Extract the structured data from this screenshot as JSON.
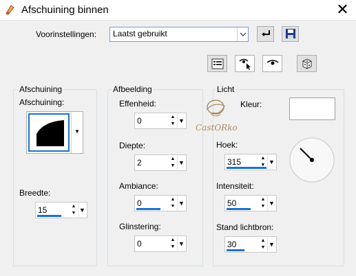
{
  "window": {
    "title": "Afschuining binnen",
    "close_glyph": "✕"
  },
  "presets": {
    "label": "Voorinstellingen:",
    "selected": "Laatst gebruikt",
    "reset_icon": "reset-icon",
    "save_icon": "save-icon"
  },
  "toolbar": {
    "icons": [
      "list-icon",
      "eye-pointer-icon",
      "eye-icon",
      "dice-icon"
    ]
  },
  "bevel_group": {
    "title": "Afschuining",
    "bevel_label": "Afschuining:",
    "width_label": "Breedte:",
    "width_value": "15",
    "width_fill": 0.6
  },
  "image_group": {
    "title": "Afbeelding",
    "smoothness_label": "Effenheid:",
    "smoothness_value": "0",
    "smoothness_fill": 0.0,
    "depth_label": "Diepte:",
    "depth_value": "2",
    "depth_fill": 0.0,
    "ambience_label": "Ambiance:",
    "ambience_value": "0",
    "ambience_fill": 0.6,
    "shine_label": "Glinstering:",
    "shine_value": "0",
    "shine_fill": 0.0
  },
  "light_group": {
    "title": "Licht",
    "color_label": "Kleur:",
    "color_value": "#ffffff",
    "angle_label": "Hoek:",
    "angle_value": "315",
    "angle_fill": 1.0,
    "intensity_label": "Intensiteit:",
    "intensity_value": "50",
    "intensity_fill": 0.6,
    "elevation_label": "Stand lichtbron:",
    "elevation_value": "30",
    "elevation_fill": 0.45
  },
  "watermark": {
    "text": "CastORko"
  },
  "colors": {
    "accent": "#1a73c8",
    "border": "#d5dfe5"
  }
}
